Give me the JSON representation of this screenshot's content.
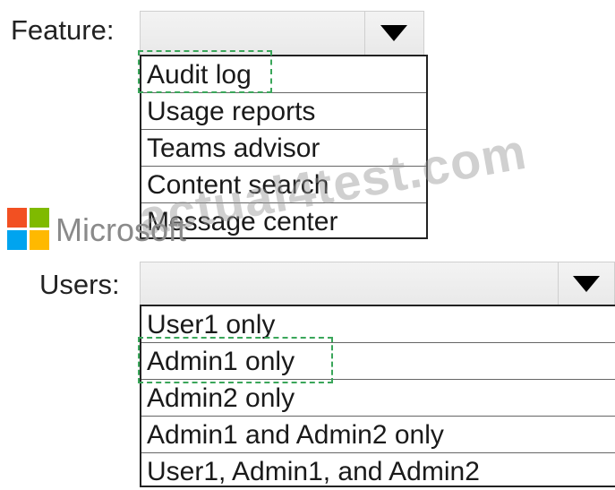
{
  "feature": {
    "label": "Feature:",
    "options": [
      "Audit log",
      "Usage reports",
      "Teams advisor",
      "Content search",
      "Message center"
    ]
  },
  "users": {
    "label": "Users:",
    "options": [
      "User1 only",
      "Admin1 only",
      "Admin2 only",
      "Admin1 and Admin2 only",
      "User1, Admin1, and Admin2"
    ]
  },
  "branding": {
    "ms_text": "Microsoft",
    "watermark": "actual4test.com",
    "logo_colors": [
      "#f25022",
      "#7fba00",
      "#00a4ef",
      "#ffb900"
    ]
  }
}
